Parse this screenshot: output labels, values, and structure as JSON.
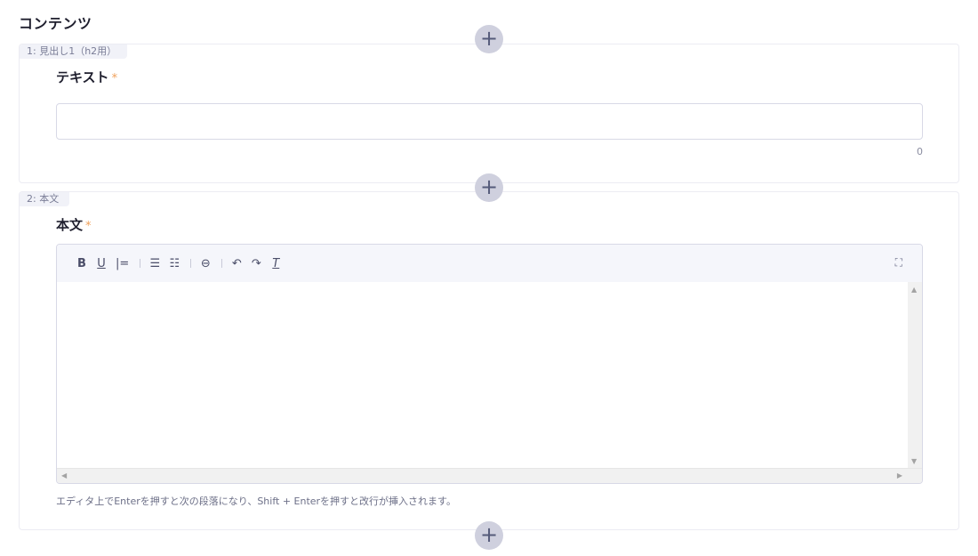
{
  "page_title": "コンテンツ",
  "add_button_symbol": "+",
  "blocks": [
    {
      "tag": "1: 見出し1（h2用）",
      "field_label": "テキスト",
      "required_mark": "*",
      "input_value": "",
      "char_count": "0"
    },
    {
      "tag": "2: 本文",
      "field_label": "本文",
      "required_mark": "*",
      "hint": "エディタ上でEnterを押すと次の段落になり、Shift + Enterを押すと改行が挿入されます。"
    }
  ],
  "toolbar": {
    "bold": "B",
    "underline": "U",
    "align": "|=",
    "bullet_list": "☰",
    "numbered_list": "☷",
    "link": "⊖",
    "undo": "↶",
    "redo": "↷",
    "clear_format": "T",
    "fullscreen": "⛶"
  },
  "icons": {
    "bold": "bold-icon",
    "underline": "underline-icon",
    "align": "align-icon",
    "bullet_list": "bullet-list-icon",
    "numbered_list": "numbered-list-icon",
    "link": "link-icon",
    "undo": "undo-icon",
    "redo": "redo-icon",
    "clear_format": "clear-format-icon",
    "fullscreen": "fullscreen-icon"
  },
  "colors": {
    "required": "#f0a05a",
    "add_button": "#cfd0de",
    "tag_bg": "#f1f2f8"
  }
}
